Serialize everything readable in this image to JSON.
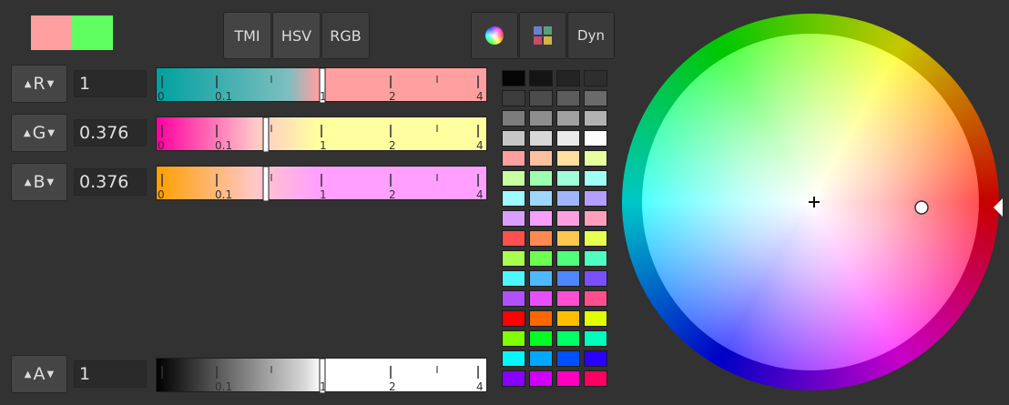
{
  "preview": {
    "new_color": "#ff9f9f",
    "old_color": "#60ff60"
  },
  "modes": [
    {
      "label": "TMI",
      "active": false
    },
    {
      "label": "HSV",
      "active": false
    },
    {
      "label": "RGB",
      "active": true
    }
  ],
  "tools": [
    {
      "icon": "color-wheel-icon"
    },
    {
      "icon": "swatches-icon"
    },
    {
      "label": "Dyn"
    }
  ],
  "channels": [
    {
      "id": "r",
      "label": "R",
      "value": "1",
      "ticks": [
        "0",
        "0.1",
        "1",
        "2",
        "4"
      ],
      "marker_fraction": 0.5
    },
    {
      "id": "g",
      "label": "G",
      "value": "0.376",
      "ticks": [
        "0",
        "0.1",
        "1",
        "2",
        "4"
      ],
      "marker_fraction": 0.33
    },
    {
      "id": "b",
      "label": "B",
      "value": "0.376",
      "ticks": [
        "0",
        "0.1",
        "1",
        "2",
        "4"
      ],
      "marker_fraction": 0.33
    },
    {
      "id": "a",
      "label": "A",
      "value": "1",
      "ticks": [
        "0.1",
        "1",
        "2",
        "4"
      ],
      "marker_fraction": 0.5
    }
  ],
  "colors": {
    "background": "#323232",
    "accent_marker": "#ffffff"
  },
  "swatch_grid": [
    [
      "#050505",
      "#141414",
      "#242424",
      "#2e2e2e"
    ],
    [
      "#3c3c3c",
      "#4c4c4c",
      "#5c5c5c",
      "#6a6a6a"
    ],
    [
      "#7c7c7c",
      "#8e8e8e",
      "#a0a0a0",
      "#b2b2b2"
    ],
    [
      "#c6c6c6",
      "#d8d8d8",
      "#eaeaea",
      "#fcfcfc"
    ],
    [
      "#ff9f9f",
      "#ffc09f",
      "#ffe09f",
      "#e8ff9f"
    ],
    [
      "#c8ff9f",
      "#9fffb0",
      "#9fffd8",
      "#9ffff6"
    ],
    [
      "#9ffbff",
      "#9fd8ff",
      "#9fb6ff",
      "#b39fff"
    ],
    [
      "#d89fff",
      "#f59fff",
      "#ff9fe0",
      "#ff9fbe"
    ],
    [
      "#ff4f4f",
      "#ff8a4f",
      "#ffc64f",
      "#e8ff4f"
    ],
    [
      "#a8ff4f",
      "#6cff4f",
      "#4fff7c",
      "#4fffc0"
    ],
    [
      "#4ff6ff",
      "#4fb9ff",
      "#4f86ff",
      "#7a4fff"
    ],
    [
      "#b24fff",
      "#e84fff",
      "#ff4fd0",
      "#ff4f8e"
    ],
    [
      "#ff0000",
      "#ff6600",
      "#ffbf00",
      "#e0ff00"
    ],
    [
      "#80ff00",
      "#00ff22",
      "#00ff66",
      "#00ffbb"
    ],
    [
      "#00f8ff",
      "#00a8ff",
      "#0050ff",
      "#2a00ff"
    ],
    [
      "#8800ff",
      "#d000ff",
      "#ff00c0",
      "#ff0060"
    ]
  ],
  "wheel": {
    "cursor_value": "0.376",
    "hue_degrees": 0
  }
}
